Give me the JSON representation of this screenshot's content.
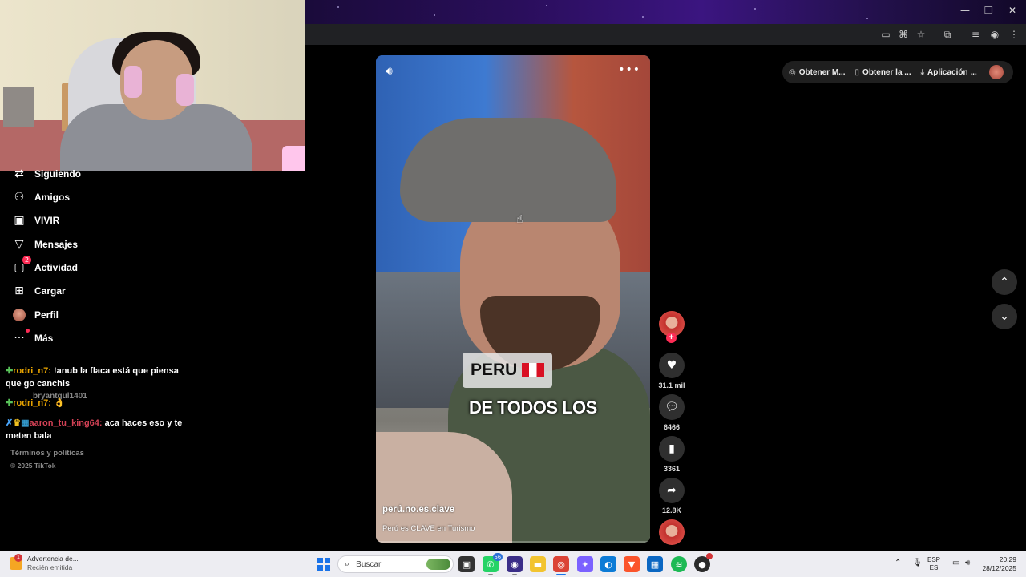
{
  "browser": {
    "window_controls": {
      "minimize": "—",
      "restore": "❐",
      "close": "✕"
    }
  },
  "sidebar": {
    "items": [
      {
        "label": "Siguiendo",
        "icon": "following-icon"
      },
      {
        "label": "Amigos",
        "icon": "friends-icon"
      },
      {
        "label": "VIVIR",
        "icon": "live-icon"
      },
      {
        "label": "Mensajes",
        "icon": "messages-icon"
      },
      {
        "label": "Actividad",
        "icon": "activity-icon",
        "badge": "2"
      },
      {
        "label": "Cargar",
        "icon": "upload-icon"
      },
      {
        "label": "Perfil",
        "icon": "profile-avatar"
      },
      {
        "label": "Más",
        "icon": "more-icon"
      }
    ]
  },
  "chat": {
    "messages": [
      {
        "user": "rodri_n7:",
        "text": " !anub la flaca está que piensa que go canchis"
      },
      {
        "user": "rodri_n7:",
        "text": " 👌"
      },
      {
        "user": "aaron_tu_king64:",
        "text": " aca haces eso y te meten bala"
      }
    ],
    "ghost_text": "bryantgul1401"
  },
  "footer": {
    "terms": "Términos y políticas",
    "copyright": "© 2025 TikTok"
  },
  "video": {
    "caption_line1": "PERU",
    "caption_line2": "DE TODOS LOS",
    "author": "perú.no.es.clave",
    "description": "Perú es CLAVE en Turismo",
    "more": "•••"
  },
  "actions": {
    "likes": "31.1 mil",
    "comments": "6466",
    "saves": "3361",
    "shares": "12.8K"
  },
  "top_pills": {
    "coins": "Obtener M...",
    "app": "Obtener la ...",
    "desktop": "Aplicación ..."
  },
  "taskbar": {
    "notification_title": "Advertencia de...",
    "notification_sub": "Recién emitida",
    "notification_count": "1",
    "search_label": "Buscar",
    "whatsapp_badge": "56",
    "lang_line1": "ESP",
    "lang_line2": "ES",
    "time": "20:29",
    "date": "28/12/2025"
  }
}
